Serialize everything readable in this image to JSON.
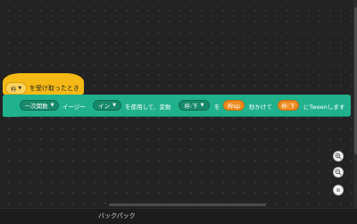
{
  "hat_block": {
    "dropdown_value": "枠",
    "text": "を受け取ったとき",
    "color": "#f5b915"
  },
  "tween_block": {
    "color": "#21b18c",
    "easing_type": "一次関数",
    "text_easing": "イージー",
    "easing_mode": "イン",
    "text_using": "を使用して、変数",
    "variable": "枠:下",
    "text_wo": "を",
    "target_value": "枠sp",
    "text_seconds": "秒かけて",
    "duration": "枠:下",
    "text_tween": "にTweenします"
  },
  "zoom_controls": {
    "zoom_in_icon": "zoom-in",
    "zoom_out_icon": "zoom-out",
    "reset_icon": "equals"
  },
  "footer": {
    "backpack_label": "バックパック"
  },
  "colors": {
    "workspace": "#232323",
    "hat": "#f5b915",
    "block": "#21b18c",
    "reporter": "#ef8a1e"
  }
}
